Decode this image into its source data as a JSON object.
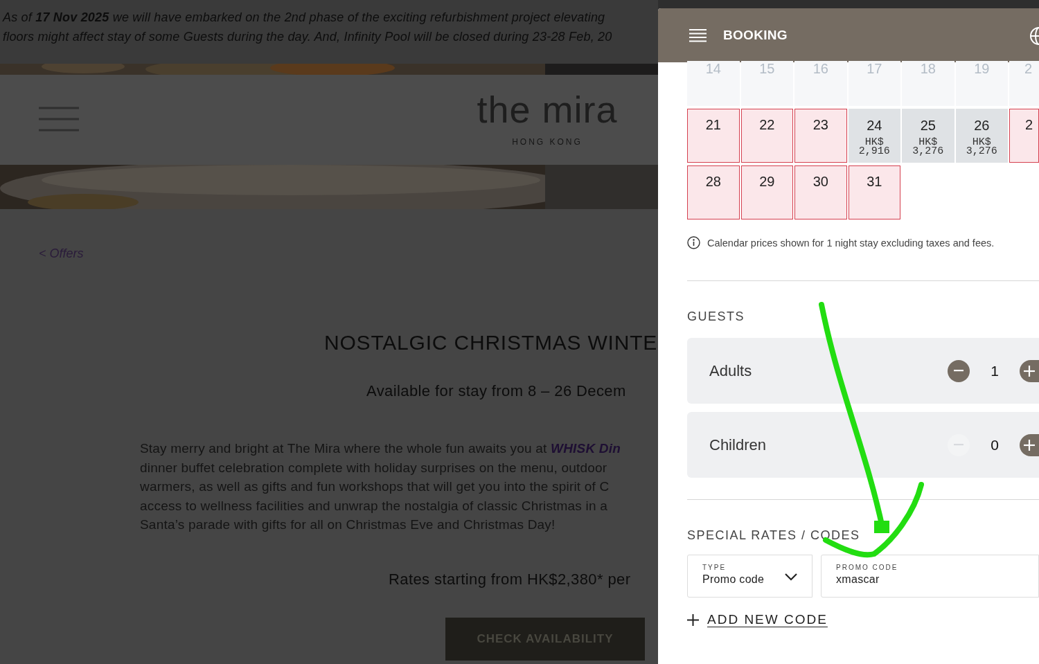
{
  "notice": {
    "lines": [
      "As of **17 Nov 2025** we will have embarked on the 2nd phase of the exciting refurbishment project elevating",
      "floors might affect stay of some Guests during the day. And, Infinity Pool will be closed during 23-28 Feb, 20"
    ]
  },
  "site_header": {
    "logo": "the mira",
    "logo_subtitle": "HONG KONG"
  },
  "back_link": "< Offers",
  "offer": {
    "title": "NOSTALGIC CHRISTMAS WINTE",
    "subtitle": "Available for stay from 8 – 26 Decem",
    "description_lines": [
      "Stay merry and bright at The Mira where the whole fun awaits you at **WHISK Din**",
      "dinner buffet celebration complete with holiday surprises on the menu, outdoor",
      "warmers, as well as gifts and fun workshops that will get you into the spirit of C",
      "access to wellness facilities and unwrap the nostalgia of classic Christmas in a",
      "Santa’s parade with gifts for all on Christmas Eve and Christmas Day!"
    ],
    "rates": "Rates starting from HK$2,380* per",
    "button": "CHECK AVAILABILITY"
  },
  "booking": {
    "title": "BOOKING",
    "calendar": {
      "weeks": [
        [
          {
            "day": "14",
            "kind": "past"
          },
          {
            "day": "15",
            "kind": "past"
          },
          {
            "day": "16",
            "kind": "past"
          },
          {
            "day": "17",
            "kind": "past"
          },
          {
            "day": "18",
            "kind": "past"
          },
          {
            "day": "19",
            "kind": "past"
          },
          {
            "day": "2",
            "kind": "past"
          }
        ],
        [
          {
            "day": "21",
            "kind": "unavailable"
          },
          {
            "day": "22",
            "kind": "unavailable"
          },
          {
            "day": "23",
            "kind": "unavailable"
          },
          {
            "day": "24",
            "kind": "available",
            "currency": "HK$",
            "price": "2,916"
          },
          {
            "day": "25",
            "kind": "available",
            "currency": "HK$",
            "price": "3,276"
          },
          {
            "day": "26",
            "kind": "available",
            "currency": "HK$",
            "price": "3,276"
          },
          {
            "day": "2",
            "kind": "unavailable"
          }
        ],
        [
          {
            "day": "28",
            "kind": "unavailable"
          },
          {
            "day": "29",
            "kind": "unavailable"
          },
          {
            "day": "30",
            "kind": "unavailable"
          },
          {
            "day": "31",
            "kind": "unavailable"
          }
        ]
      ]
    },
    "calendar_note": "Calendar prices shown for 1 night stay excluding taxes and fees.",
    "guests": {
      "title": "GUESTS",
      "rows": [
        {
          "label": "Adults",
          "value": "1",
          "can_decrease": true
        },
        {
          "label": "Children",
          "value": "0",
          "can_decrease": false
        }
      ]
    },
    "special_rates": {
      "title": "SPECIAL RATES / CODES",
      "type_field": {
        "label": "TYPE",
        "value": "Promo code"
      },
      "promo_field": {
        "label": "PROMO CODE",
        "value": "xmascar"
      },
      "add_link": "ADD NEW CODE"
    }
  }
}
